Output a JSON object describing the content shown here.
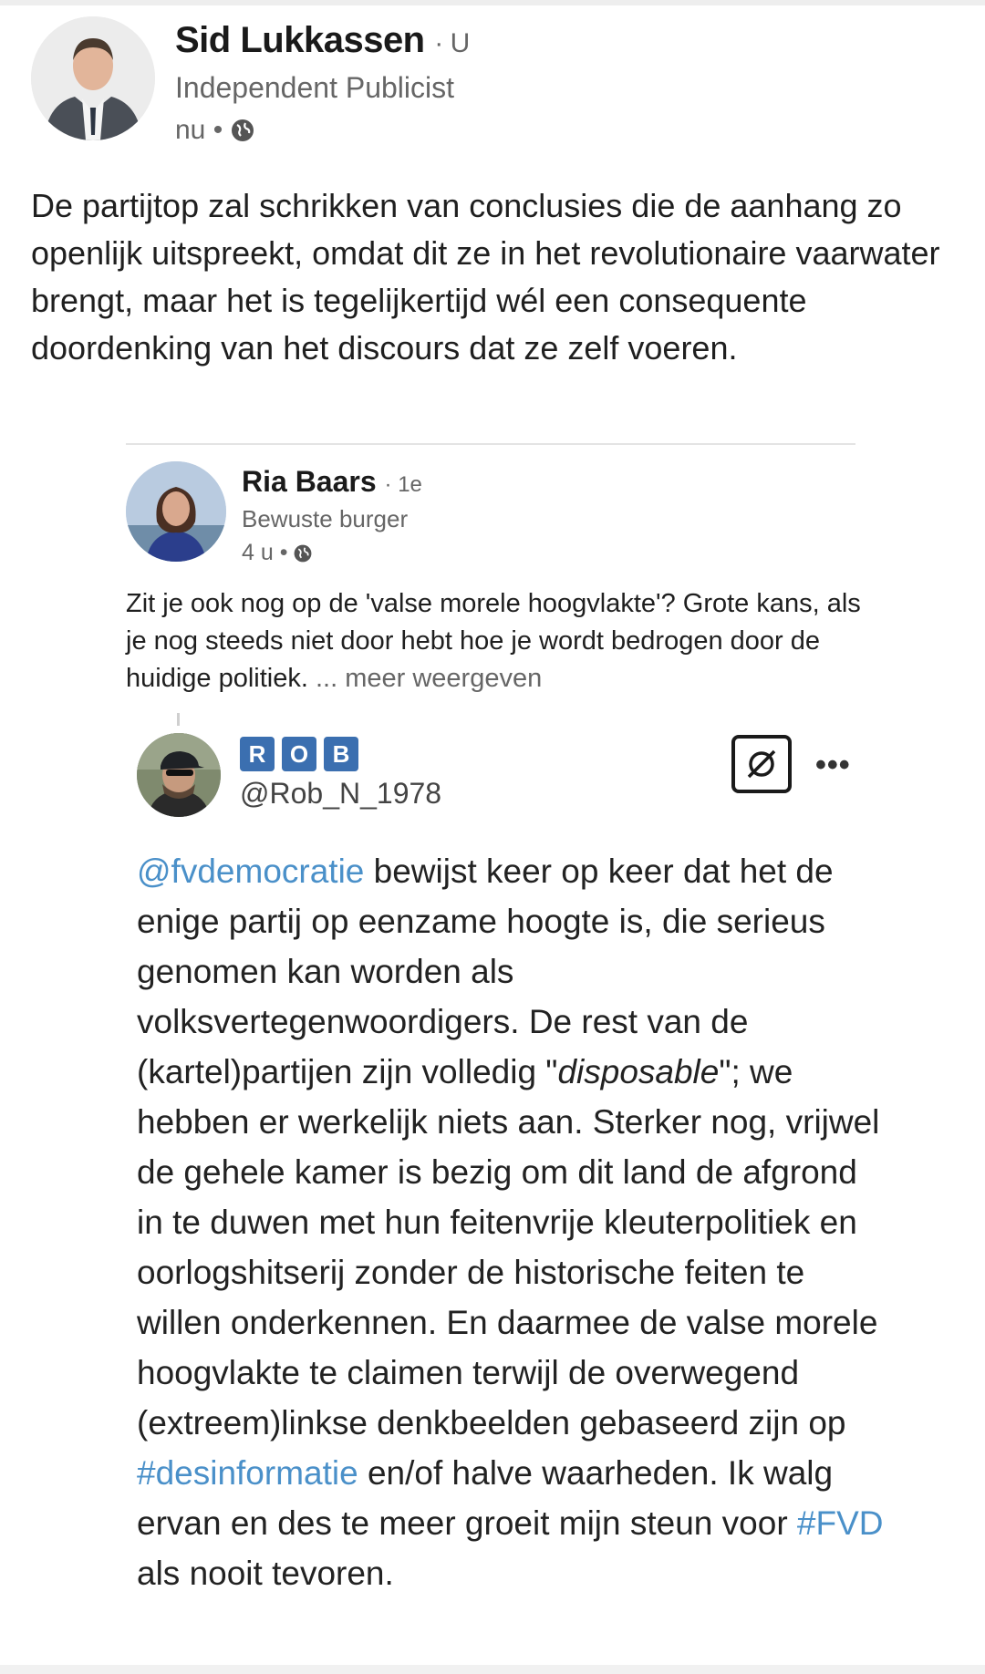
{
  "post": {
    "author": {
      "name": "Sid Lukkassen",
      "degree": "· U",
      "headline": "Independent Publicist",
      "time": "nu •",
      "visibility_icon": "globe-icon"
    },
    "text": "De partijtop zal schrikken van conclusies die de aanhang zo openlijk uitspreekt, omdat dit ze in het revolutionaire vaarwater brengt, maar het is tegelijkertijd wél een consequente doordenking van het discours dat ze zelf voeren."
  },
  "reshared": {
    "author": {
      "name": "Ria Baars",
      "degree": "· 1e",
      "headline": "Bewuste burger",
      "time": "4 u •",
      "visibility_icon": "globe-icon"
    },
    "text": "Zit je ook nog op de 'valse morele hoogvlakte'? Grote kans, als je nog steeds niet door hebt hoe je wordt bedrogen door de huidige politiek.",
    "see_more": "... meer weergeven"
  },
  "tweet": {
    "badges": [
      "R",
      "O",
      "B"
    ],
    "handle": "@Rob_N_1978",
    "more_icon": "more-dots-icon",
    "box_icon": "no-symbol-icon",
    "text": {
      "mention": "@fvdemocratie",
      "part1": " bewijst keer op keer dat het de enige partij op eenzame hoogte is, die serieus genomen kan worden als volksvertegenwoordigers. De rest van de (kartel)partijen zijn volledig \"",
      "italic": "disposable",
      "part2": "\"; we hebben er werkelijk niets aan. Sterker nog, vrijwel de gehele kamer is bezig om dit land de afgrond in te duwen met hun feitenvrije kleuterpolitiek en oorlogshitserij zonder de historische feiten te willen onderkennen. En daarmee de valse morele hoogvlakte te claimen terwijl de overwegend (extreem)linkse denkbeelden gebaseerd zijn op ",
      "hashtag1": "#desinformatie",
      "part3": " en/of halve waarheden. Ik walg ervan en des te meer groeit mijn steun voor ",
      "hashtag2": "#FVD",
      "part4": " als nooit tevoren."
    }
  },
  "colors": {
    "link": "#4a90c9",
    "badge": "#3b6fb0",
    "muted": "#666666"
  }
}
